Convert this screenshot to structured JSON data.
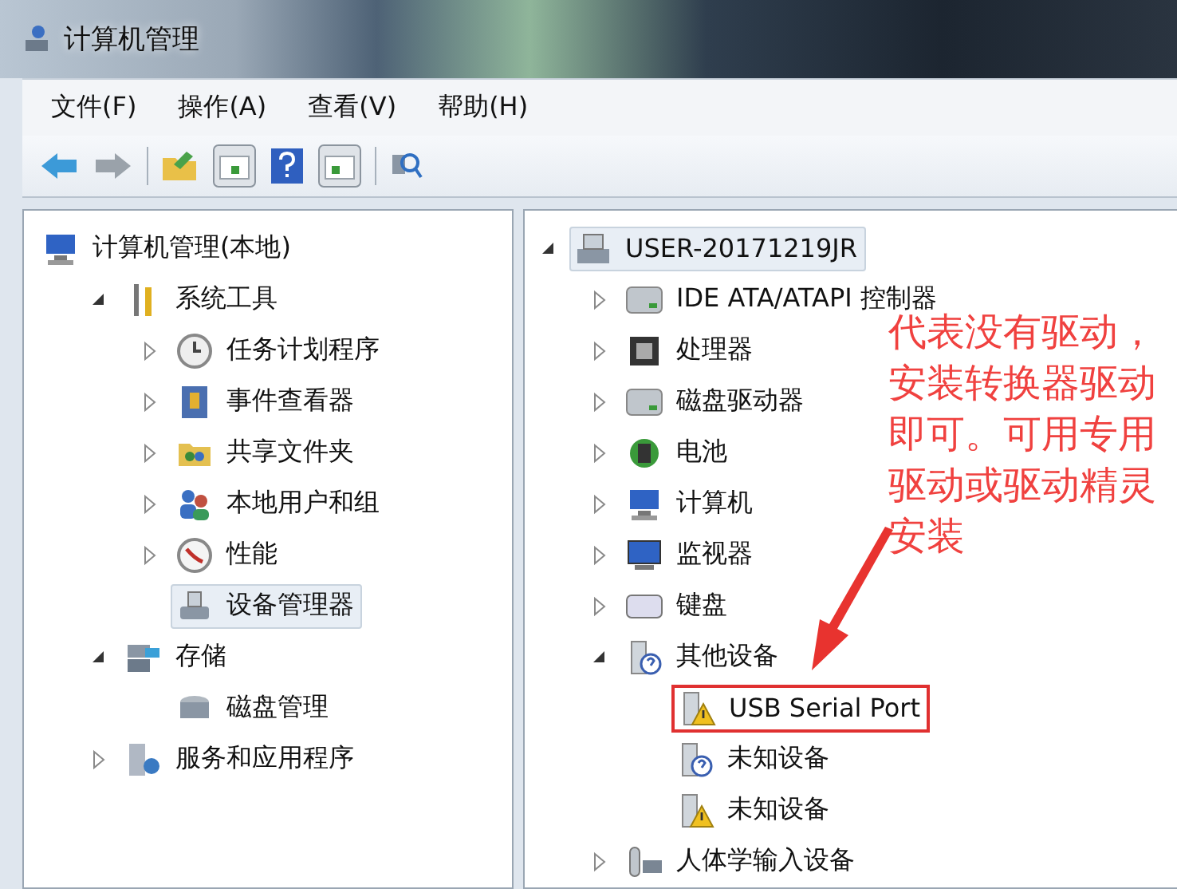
{
  "window": {
    "title": "计算机管理"
  },
  "menu": [
    {
      "label": "文件(F)"
    },
    {
      "label": "操作(A)"
    },
    {
      "label": "查看(V)"
    },
    {
      "label": "帮助(H)"
    }
  ],
  "left_tree": [
    {
      "label": "计算机管理(本地)",
      "selected": false,
      "children": [
        {
          "label": "系统工具",
          "expanded": true,
          "selected": false,
          "children": [
            {
              "label": "任务计划程序",
              "expanded": false,
              "selected": false
            },
            {
              "label": "事件查看器",
              "expanded": false,
              "selected": false
            },
            {
              "label": "共享文件夹",
              "expanded": false,
              "selected": false
            },
            {
              "label": "本地用户和组",
              "expanded": false,
              "selected": false
            },
            {
              "label": "性能",
              "expanded": false,
              "selected": false
            },
            {
              "label": "设备管理器",
              "selected": true
            }
          ]
        },
        {
          "label": "存储",
          "expanded": true,
          "selected": false,
          "children": [
            {
              "label": "磁盘管理",
              "selected": false
            }
          ]
        },
        {
          "label": "服务和应用程序",
          "expanded": false,
          "selected": false
        }
      ]
    }
  ],
  "right_tree": [
    {
      "label": "USER-20171219JR",
      "expanded": true,
      "selected": true,
      "children": [
        {
          "label": "IDE ATA/ATAPI 控制器",
          "expanded": false,
          "selected": false
        },
        {
          "label": "处理器",
          "expanded": false,
          "selected": false
        },
        {
          "label": "磁盘驱动器",
          "expanded": false,
          "selected": false
        },
        {
          "label": "电池",
          "expanded": false,
          "selected": false
        },
        {
          "label": "计算机",
          "expanded": false,
          "selected": false
        },
        {
          "label": "监视器",
          "expanded": false,
          "selected": false
        },
        {
          "label": "键盘",
          "expanded": false,
          "selected": false
        },
        {
          "label": "其他设备",
          "expanded": true,
          "selected": false,
          "children": [
            {
              "label": "USB Serial Port",
              "selected": false,
              "marked": true
            },
            {
              "label": "未知设备",
              "selected": false
            },
            {
              "label": "未知设备",
              "selected": false
            }
          ]
        },
        {
          "label": "人体学输入设备",
          "expanded": false,
          "selected": false
        }
      ]
    }
  ],
  "annotation": {
    "text": "代表没有驱动，安装转换器驱动即可。可用专用驱动或驱动精灵安装"
  }
}
